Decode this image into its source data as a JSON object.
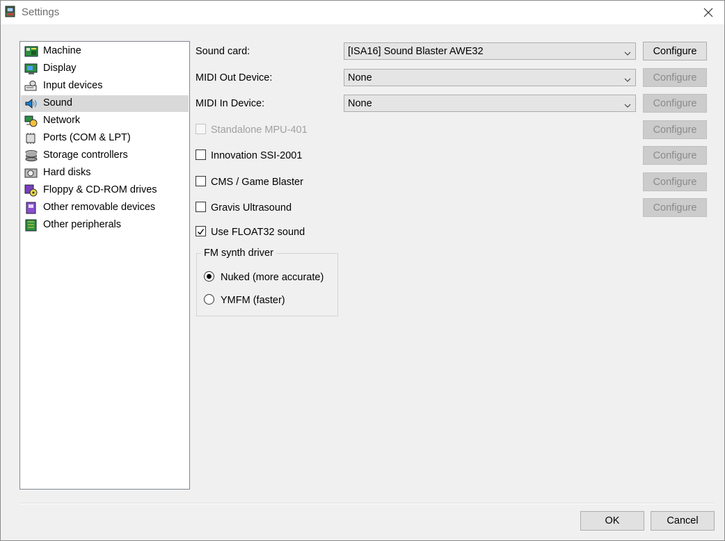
{
  "window": {
    "title": "Settings",
    "close_icon": "close-icon"
  },
  "categories": [
    {
      "label": "Machine",
      "icon": "machine-icon"
    },
    {
      "label": "Display",
      "icon": "display-icon"
    },
    {
      "label": "Input devices",
      "icon": "input-devices-icon"
    },
    {
      "label": "Sound",
      "icon": "sound-icon",
      "selected": true
    },
    {
      "label": "Network",
      "icon": "network-icon"
    },
    {
      "label": "Ports (COM & LPT)",
      "icon": "ports-icon"
    },
    {
      "label": "Storage controllers",
      "icon": "storage-controllers-icon"
    },
    {
      "label": "Hard disks",
      "icon": "hard-disk-icon"
    },
    {
      "label": "Floppy & CD-ROM drives",
      "icon": "floppy-cdrom-icon"
    },
    {
      "label": "Other removable devices",
      "icon": "removable-devices-icon"
    },
    {
      "label": "Other peripherals",
      "icon": "peripherals-icon"
    }
  ],
  "sound": {
    "sound_card": {
      "label": "Sound card:",
      "value": "[ISA16] Sound Blaster AWE32",
      "configure": "Configure",
      "configure_enabled": true
    },
    "midi_out": {
      "label": "MIDI Out Device:",
      "value": "None",
      "configure": "Configure",
      "configure_enabled": false
    },
    "midi_in": {
      "label": "MIDI In Device:",
      "value": "None",
      "configure": "Configure",
      "configure_enabled": false
    },
    "standalone_mpu": {
      "label": "Standalone MPU-401",
      "checked": false,
      "enabled": false,
      "configure": "Configure"
    },
    "innovation": {
      "label": "Innovation SSI-2001",
      "checked": false,
      "configure": "Configure"
    },
    "cms": {
      "label": "CMS / Game Blaster",
      "checked": false,
      "configure": "Configure"
    },
    "gravis": {
      "label": "Gravis Ultrasound",
      "checked": false,
      "configure": "Configure"
    },
    "float32": {
      "label": "Use FLOAT32 sound",
      "checked": true
    },
    "fm_synth": {
      "title": "FM synth driver",
      "options": [
        {
          "label": "Nuked (more accurate)",
          "selected": true
        },
        {
          "label": "YMFM (faster)",
          "selected": false
        }
      ]
    }
  },
  "buttons": {
    "ok": "OK",
    "cancel": "Cancel"
  }
}
